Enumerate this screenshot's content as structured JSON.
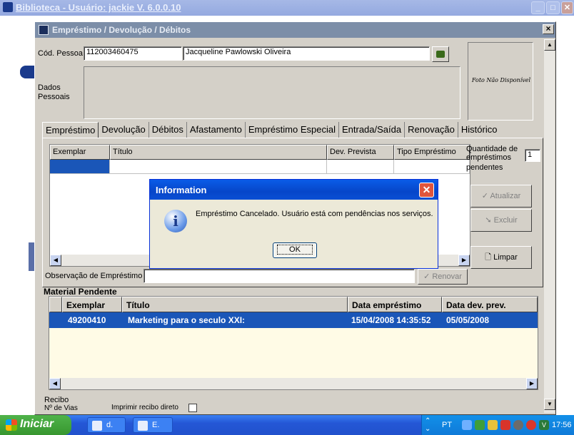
{
  "app": {
    "title": "Biblioteca - Usuário: jackie   V. 6.0.0.10"
  },
  "dialog": {
    "title": "Empréstimo / Devolução / Débitos",
    "person_code_label": "Cód. Pessoa",
    "person_code": "112003460475",
    "person_name": "Jacqueline Pawlowski Oliveira",
    "personal_data_label_1": "Dados",
    "personal_data_label_2": "Pessoais",
    "photo_placeholder": "Foto Não Disponível"
  },
  "tabs": [
    {
      "label": "Empréstimo",
      "active": true
    },
    {
      "label": "Devolução"
    },
    {
      "label": "Débitos"
    },
    {
      "label": "Afastamento"
    },
    {
      "label": "Empréstimo Especial"
    },
    {
      "label": "Entrada/Saída"
    },
    {
      "label": "Renovação"
    },
    {
      "label": "Histórico"
    }
  ],
  "loan_grid": {
    "columns": [
      "Exemplar",
      "Título",
      "Dev. Prevista",
      "Tipo Empréstimo"
    ]
  },
  "pending_count": {
    "label_1": "Quantidade de",
    "label_2": "empréstimos",
    "label_3": "pendentes",
    "value": "1"
  },
  "buttons": {
    "update": "Atualizar",
    "delete": "Excluir",
    "clear": "Limpar",
    "renew": "Renovar"
  },
  "observation": {
    "label": "Observação de Empréstimo",
    "value": ""
  },
  "pending_material": {
    "title": "Material Pendente",
    "columns": [
      "Exemplar",
      "Título",
      "Data empréstimo",
      "Data dev. prev."
    ],
    "rows": [
      {
        "exemplar": "49200410",
        "titulo": "Marketing para o seculo XXI:",
        "data_emprestimo": "15/04/2008 14:35:52",
        "data_dev": "05/05/2008"
      }
    ]
  },
  "receipt": {
    "group_label": "Recibo",
    "copies_label": "Nº de Vias",
    "direct_print_label": "Imprimir recibo direto"
  },
  "info_dialog": {
    "title": "Information",
    "message": "Empréstimo Cancelado. Usuário está com pendências nos serviços.",
    "ok": "OK"
  },
  "taskbar": {
    "start": "Iniciar",
    "tasks": [
      "d.",
      "E."
    ],
    "lang": "PT",
    "clock": "17:56"
  }
}
